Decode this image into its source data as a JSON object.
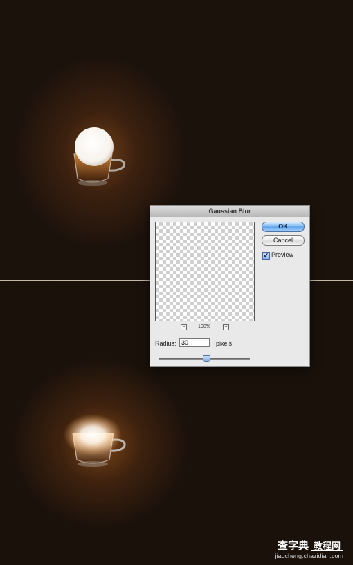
{
  "dialog": {
    "title": "Gaussian Blur",
    "ok_label": "OK",
    "cancel_label": "Cancel",
    "preview_label": "Preview",
    "preview_checked": true,
    "zoom": {
      "minus": "−",
      "value": "100%",
      "plus": "+"
    },
    "radius_label": "Radius:",
    "radius_value": "30",
    "radius_units": "pixels",
    "slider_fraction": 0.52
  },
  "watermark": {
    "brand": "查字典",
    "section": "教程网",
    "url": "jiaocheng.chazidian.com"
  },
  "colors": {
    "background": "#1c120c",
    "glow": "#b06020",
    "ok_button": "#78b4f0"
  }
}
